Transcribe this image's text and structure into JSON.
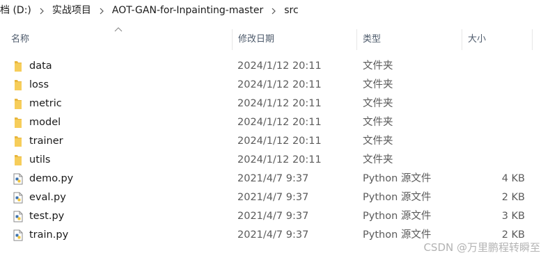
{
  "breadcrumb": [
    "档 (D:)",
    "实战项目",
    "AOT-GAN-for-Inpainting-master",
    "src"
  ],
  "columns": {
    "name": "名称",
    "date": "修改日期",
    "type": "类型",
    "size": "大小"
  },
  "files": [
    {
      "name": "data",
      "date": "2024/1/12 20:11",
      "type": "文件夹",
      "size": "",
      "icon": "folder-icon"
    },
    {
      "name": "loss",
      "date": "2024/1/12 20:11",
      "type": "文件夹",
      "size": "",
      "icon": "folder-icon"
    },
    {
      "name": "metric",
      "date": "2024/1/12 20:11",
      "type": "文件夹",
      "size": "",
      "icon": "folder-icon"
    },
    {
      "name": "model",
      "date": "2024/1/12 20:11",
      "type": "文件夹",
      "size": "",
      "icon": "folder-icon"
    },
    {
      "name": "trainer",
      "date": "2024/1/12 20:11",
      "type": "文件夹",
      "size": "",
      "icon": "folder-icon"
    },
    {
      "name": "utils",
      "date": "2024/1/12 20:11",
      "type": "文件夹",
      "size": "",
      "icon": "folder-icon"
    },
    {
      "name": "demo.py",
      "date": "2021/4/7 9:37",
      "type": "Python 源文件",
      "size": "4 KB",
      "icon": "python-file-icon"
    },
    {
      "name": "eval.py",
      "date": "2021/4/7 9:37",
      "type": "Python 源文件",
      "size": "2 KB",
      "icon": "python-file-icon"
    },
    {
      "name": "test.py",
      "date": "2021/4/7 9:37",
      "type": "Python 源文件",
      "size": "3 KB",
      "icon": "python-file-icon"
    },
    {
      "name": "train.py",
      "date": "2021/4/7 9:37",
      "type": "Python 源文件",
      "size": "2 KB",
      "icon": "python-file-icon"
    }
  ],
  "watermark": "CSDN @万里鹏程转瞬至",
  "colors": {
    "folder": "#e8b63c",
    "python_blue": "#3b72b0",
    "python_yellow": "#f2c53d",
    "header_text": "#4d5a6b"
  }
}
